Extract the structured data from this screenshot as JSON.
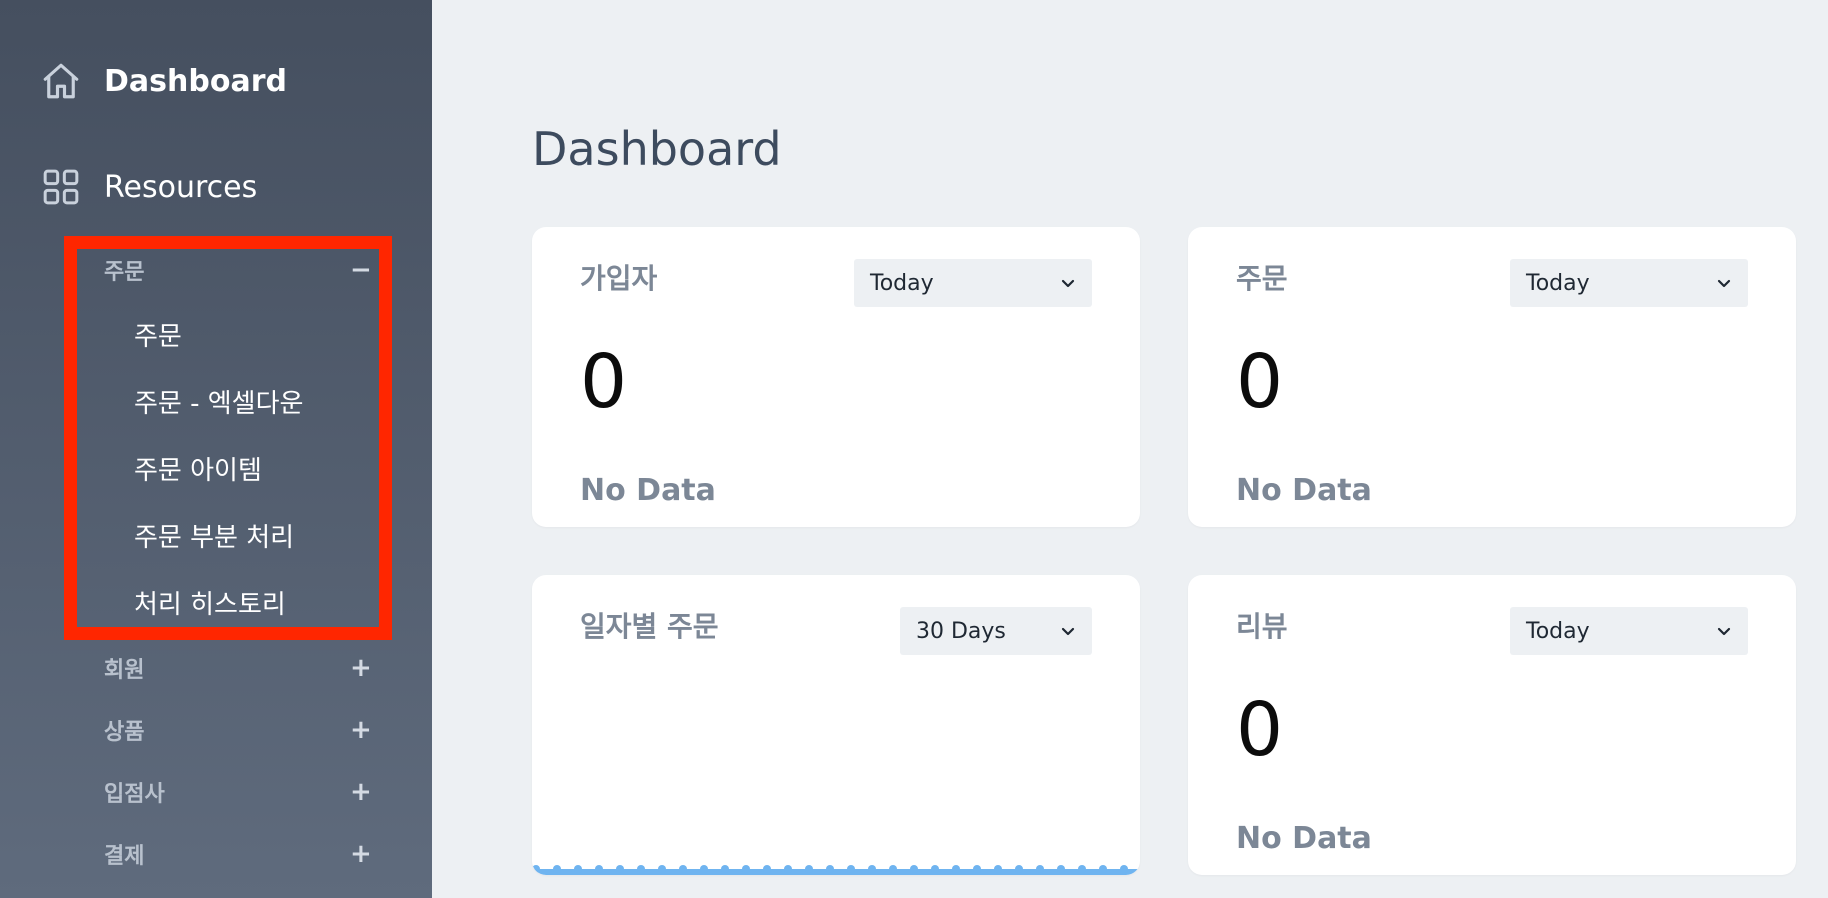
{
  "sidebar": {
    "dashboard_label": "Dashboard",
    "resources_label": "Resources",
    "groups": [
      {
        "label": "주문",
        "toggle": "−"
      },
      {
        "label": "회원",
        "toggle": "+"
      },
      {
        "label": "상품",
        "toggle": "+"
      },
      {
        "label": "입점사",
        "toggle": "+"
      },
      {
        "label": "결제",
        "toggle": "+"
      }
    ],
    "order_items": [
      {
        "label": "주문"
      },
      {
        "label": "주문 - 엑셀다운"
      },
      {
        "label": "주문 아이템"
      },
      {
        "label": "주문 부분 처리"
      },
      {
        "label": "처리 히스토리"
      }
    ],
    "highlight_color": "#ff2600"
  },
  "main": {
    "title": "Dashboard",
    "cards": [
      {
        "title": "가입자",
        "range": "Today",
        "value": "0",
        "subtitle": "No Data"
      },
      {
        "title": "주문",
        "range": "Today",
        "value": "0",
        "subtitle": "No Data"
      },
      {
        "title": "일자별 주문",
        "range": "30 Days"
      },
      {
        "title": "리뷰",
        "range": "Today",
        "value": "0",
        "subtitle": "No Data"
      }
    ]
  },
  "icons": {
    "dashboard": "home-icon",
    "resources": "grid-icon",
    "dropdown": "chevron-down-icon"
  },
  "colors": {
    "sidebar_top": "#454f5f",
    "sidebar_bottom": "#5f6b7d",
    "background": "#edf0f3",
    "chart_line": "#6fb4f0"
  }
}
